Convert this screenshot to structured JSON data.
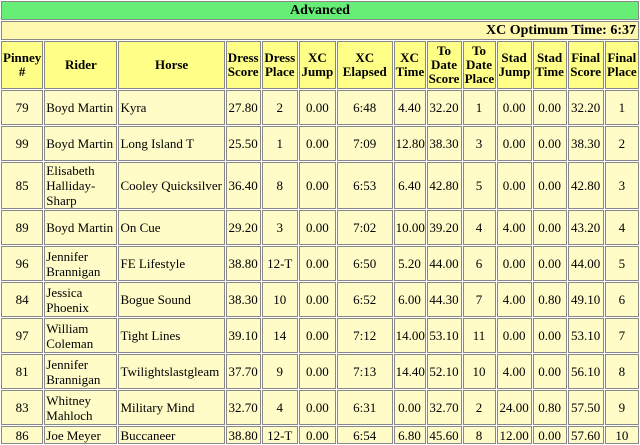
{
  "division": "Advanced",
  "optimum_time_label": "XC Optimum Time: 6:37",
  "headers": [
    "Pinney #",
    "Rider",
    "Horse",
    "Dress Score",
    "Dress Place",
    "XC Jump",
    "XC Elapsed",
    "XC Time",
    "To Date Score",
    "To Date Place",
    "Stad Jump",
    "Stad Time",
    "Final Score",
    "Final Place"
  ],
  "rows": [
    [
      "79",
      "Boyd Martin",
      "Kyra",
      "27.80",
      "2",
      "0.00",
      "6:48",
      "4.40",
      "32.20",
      "1",
      "0.00",
      "0.00",
      "32.20",
      "1"
    ],
    [
      "99",
      "Boyd Martin",
      "Long Island T",
      "25.50",
      "1",
      "0.00",
      "7:09",
      "12.80",
      "38.30",
      "3",
      "0.00",
      "0.00",
      "38.30",
      "2"
    ],
    [
      "85",
      "Elisabeth Halliday-Sharp",
      "Cooley Quicksilver",
      "36.40",
      "8",
      "0.00",
      "6:53",
      "6.40",
      "42.80",
      "5",
      "0.00",
      "0.00",
      "42.80",
      "3"
    ],
    [
      "89",
      "Boyd Martin",
      "On Cue",
      "29.20",
      "3",
      "0.00",
      "7:02",
      "10.00",
      "39.20",
      "4",
      "4.00",
      "0.00",
      "43.20",
      "4"
    ],
    [
      "96",
      "Jennifer Brannigan",
      "FE Lifestyle",
      "38.80",
      "12-T",
      "0.00",
      "6:50",
      "5.20",
      "44.00",
      "6",
      "0.00",
      "0.00",
      "44.00",
      "5"
    ],
    [
      "84",
      "Jessica Phoenix",
      "Bogue Sound",
      "38.30",
      "10",
      "0.00",
      "6:52",
      "6.00",
      "44.30",
      "7",
      "4.00",
      "0.80",
      "49.10",
      "6"
    ],
    [
      "97",
      "William Coleman",
      "Tight Lines",
      "39.10",
      "14",
      "0.00",
      "7:12",
      "14.00",
      "53.10",
      "11",
      "0.00",
      "0.00",
      "53.10",
      "7"
    ],
    [
      "81",
      "Jennifer Brannigan",
      "Twilightslastgleam",
      "37.70",
      "9",
      "0.00",
      "7:13",
      "14.40",
      "52.10",
      "10",
      "4.00",
      "0.00",
      "56.10",
      "8"
    ],
    [
      "83",
      "Whitney Mahloch",
      "Military Mind",
      "32.70",
      "4",
      "0.00",
      "6:31",
      "0.00",
      "32.70",
      "2",
      "24.00",
      "0.80",
      "57.50",
      "9"
    ],
    [
      "86",
      "Joe Meyer",
      "Buccaneer",
      "38.80",
      "12-T",
      "0.00",
      "6:54",
      "6.80",
      "45.60",
      "8",
      "12.00",
      "0.00",
      "57.60",
      "10"
    ]
  ],
  "colors": {
    "title_bg": "#66ee77",
    "header_bg": "#ffff88",
    "row_bg": "#fffcc8"
  }
}
